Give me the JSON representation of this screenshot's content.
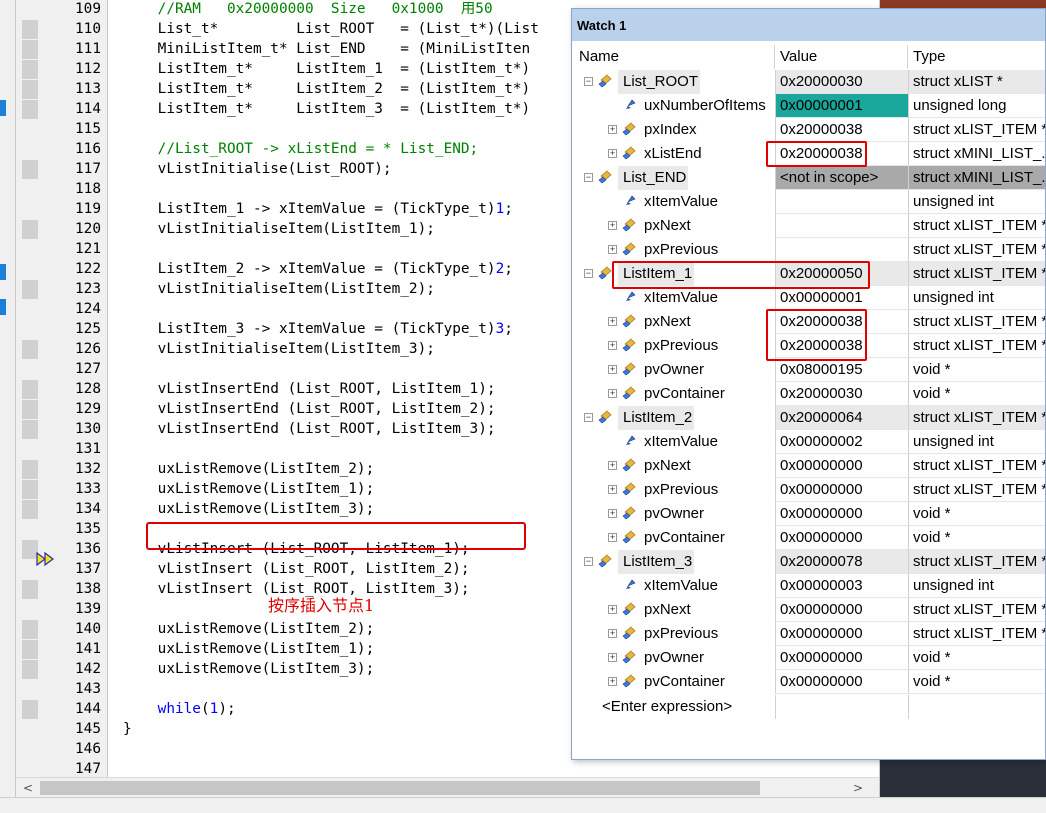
{
  "editor": {
    "lines": [
      {
        "no": "109",
        "code": "    //RAM   0x20000000  Size   0x1000  用50"
      },
      {
        "no": "110",
        "code": "    List_t*         List_ROOT   = (List_t*)(List"
      },
      {
        "no": "111",
        "code": "    MiniListItem_t* List_END    = (MiniListIten"
      },
      {
        "no": "112",
        "code": "    ListItem_t*     ListItem_1  = (ListItem_t*)"
      },
      {
        "no": "113",
        "code": "    ListItem_t*     ListItem_2  = (ListItem_t*)"
      },
      {
        "no": "114",
        "code": "    ListItem_t*     ListItem_3  = (ListItem_t*)"
      },
      {
        "no": "115",
        "code": ""
      },
      {
        "no": "116",
        "code": "    //List_ROOT -> xListEnd = * List_END;"
      },
      {
        "no": "117",
        "code": "    vListInitialise(List_ROOT);"
      },
      {
        "no": "118",
        "code": ""
      },
      {
        "no": "119",
        "code": "    ListItem_1 -> xItemValue = (TickType_t)1;"
      },
      {
        "no": "120",
        "code": "    vListInitialiseItem(ListItem_1);"
      },
      {
        "no": "121",
        "code": ""
      },
      {
        "no": "122",
        "code": "    ListItem_2 -> xItemValue = (TickType_t)2;"
      },
      {
        "no": "123",
        "code": "    vListInitialiseItem(ListItem_2);"
      },
      {
        "no": "124",
        "code": ""
      },
      {
        "no": "125",
        "code": "    ListItem_3 -> xItemValue = (TickType_t)3;"
      },
      {
        "no": "126",
        "code": "    vListInitialiseItem(ListItem_3);"
      },
      {
        "no": "127",
        "code": ""
      },
      {
        "no": "128",
        "code": "    vListInsertEnd (List_ROOT, ListItem_1);"
      },
      {
        "no": "129",
        "code": "    vListInsertEnd (List_ROOT, ListItem_2);"
      },
      {
        "no": "130",
        "code": "    vListInsertEnd (List_ROOT, ListItem_3);"
      },
      {
        "no": "131",
        "code": ""
      },
      {
        "no": "132",
        "code": "    uxListRemove(ListItem_2);"
      },
      {
        "no": "133",
        "code": "    uxListRemove(ListItem_1);"
      },
      {
        "no": "134",
        "code": "    uxListRemove(ListItem_3);"
      },
      {
        "no": "135",
        "code": ""
      },
      {
        "no": "136",
        "code": "    vListInsert (List_ROOT, ListItem_1);"
      },
      {
        "no": "137",
        "code": "    vListInsert (List_ROOT, ListItem_2);"
      },
      {
        "no": "138",
        "code": "    vListInsert (List_ROOT, ListItem_3);"
      },
      {
        "no": "139",
        "code": ""
      },
      {
        "no": "140",
        "code": "    uxListRemove(ListItem_2);"
      },
      {
        "no": "141",
        "code": "    uxListRemove(ListItem_1);"
      },
      {
        "no": "142",
        "code": "    uxListRemove(ListItem_3);"
      },
      {
        "no": "143",
        "code": ""
      },
      {
        "no": "144",
        "code": "    while(1);"
      },
      {
        "no": "145",
        "code": "}"
      },
      {
        "no": "146",
        "code": ""
      },
      {
        "no": "147",
        "code": ""
      }
    ],
    "annotation": "按序插入节点1",
    "current_line": "137"
  },
  "watch": {
    "title": "Watch 1",
    "columns": {
      "name": "Name",
      "value": "Value",
      "type": "Type"
    },
    "rows": [
      {
        "name": "List_ROOT",
        "value": "0x20000030",
        "type": "struct xLIST *",
        "level": 0,
        "expander": "-"
      },
      {
        "name": "uxNumberOfItems",
        "value": "0x00000001",
        "type": "unsigned long",
        "level": 1,
        "expander": ""
      },
      {
        "name": "pxIndex",
        "value": "0x20000038",
        "type": "struct xLIST_ITEM *",
        "level": 1,
        "expander": "+"
      },
      {
        "name": "xListEnd",
        "value": "0x20000038",
        "type": "struct xMINI_LIST_...",
        "level": 1,
        "expander": "+"
      },
      {
        "name": "List_END",
        "value": "<not in scope>",
        "type": "struct xMINI_LIST_...",
        "level": 0,
        "expander": "-"
      },
      {
        "name": "xItemValue",
        "value": "",
        "type": "unsigned int",
        "level": 1,
        "expander": ""
      },
      {
        "name": "pxNext",
        "value": "",
        "type": "struct xLIST_ITEM *",
        "level": 1,
        "expander": "+"
      },
      {
        "name": "pxPrevious",
        "value": "",
        "type": "struct xLIST_ITEM *",
        "level": 1,
        "expander": "+"
      },
      {
        "name": "ListItem_1",
        "value": "0x20000050",
        "type": "struct xLIST_ITEM *",
        "level": 0,
        "expander": "-"
      },
      {
        "name": "xItemValue",
        "value": "0x00000001",
        "type": "unsigned int",
        "level": 1,
        "expander": ""
      },
      {
        "name": "pxNext",
        "value": "0x20000038",
        "type": "struct xLIST_ITEM *",
        "level": 1,
        "expander": "+"
      },
      {
        "name": "pxPrevious",
        "value": "0x20000038",
        "type": "struct xLIST_ITEM *",
        "level": 1,
        "expander": "+"
      },
      {
        "name": "pvOwner",
        "value": "0x08000195",
        "type": "void *",
        "level": 1,
        "expander": "+"
      },
      {
        "name": "pvContainer",
        "value": "0x20000030",
        "type": "void *",
        "level": 1,
        "expander": "+"
      },
      {
        "name": "ListItem_2",
        "value": "0x20000064",
        "type": "struct xLIST_ITEM *",
        "level": 0,
        "expander": "-"
      },
      {
        "name": "xItemValue",
        "value": "0x00000002",
        "type": "unsigned int",
        "level": 1,
        "expander": ""
      },
      {
        "name": "pxNext",
        "value": "0x00000000",
        "type": "struct xLIST_ITEM *",
        "level": 1,
        "expander": "+"
      },
      {
        "name": "pxPrevious",
        "value": "0x00000000",
        "type": "struct xLIST_ITEM *",
        "level": 1,
        "expander": "+"
      },
      {
        "name": "pvOwner",
        "value": "0x00000000",
        "type": "void *",
        "level": 1,
        "expander": "+"
      },
      {
        "name": "pvContainer",
        "value": "0x00000000",
        "type": "void *",
        "level": 1,
        "expander": "+"
      },
      {
        "name": "ListItem_3",
        "value": "0x20000078",
        "type": "struct xLIST_ITEM *",
        "level": 0,
        "expander": "-"
      },
      {
        "name": "xItemValue",
        "value": "0x00000003",
        "type": "unsigned int",
        "level": 1,
        "expander": ""
      },
      {
        "name": "pxNext",
        "value": "0x00000000",
        "type": "struct xLIST_ITEM *",
        "level": 1,
        "expander": "+"
      },
      {
        "name": "pxPrevious",
        "value": "0x00000000",
        "type": "struct xLIST_ITEM *",
        "level": 1,
        "expander": "+"
      },
      {
        "name": "pvOwner",
        "value": "0x00000000",
        "type": "void *",
        "level": 1,
        "expander": "+"
      },
      {
        "name": "pvContainer",
        "value": "0x00000000",
        "type": "void *",
        "level": 1,
        "expander": "+"
      }
    ],
    "enter_expression": "<Enter expression>"
  },
  "colors": {
    "highlight_red": "#e00000",
    "teal_value": "#1aa79b",
    "title_bar": "#b9d1ea",
    "comment_green": "#008000",
    "keyword_blue": "#0000ff"
  }
}
